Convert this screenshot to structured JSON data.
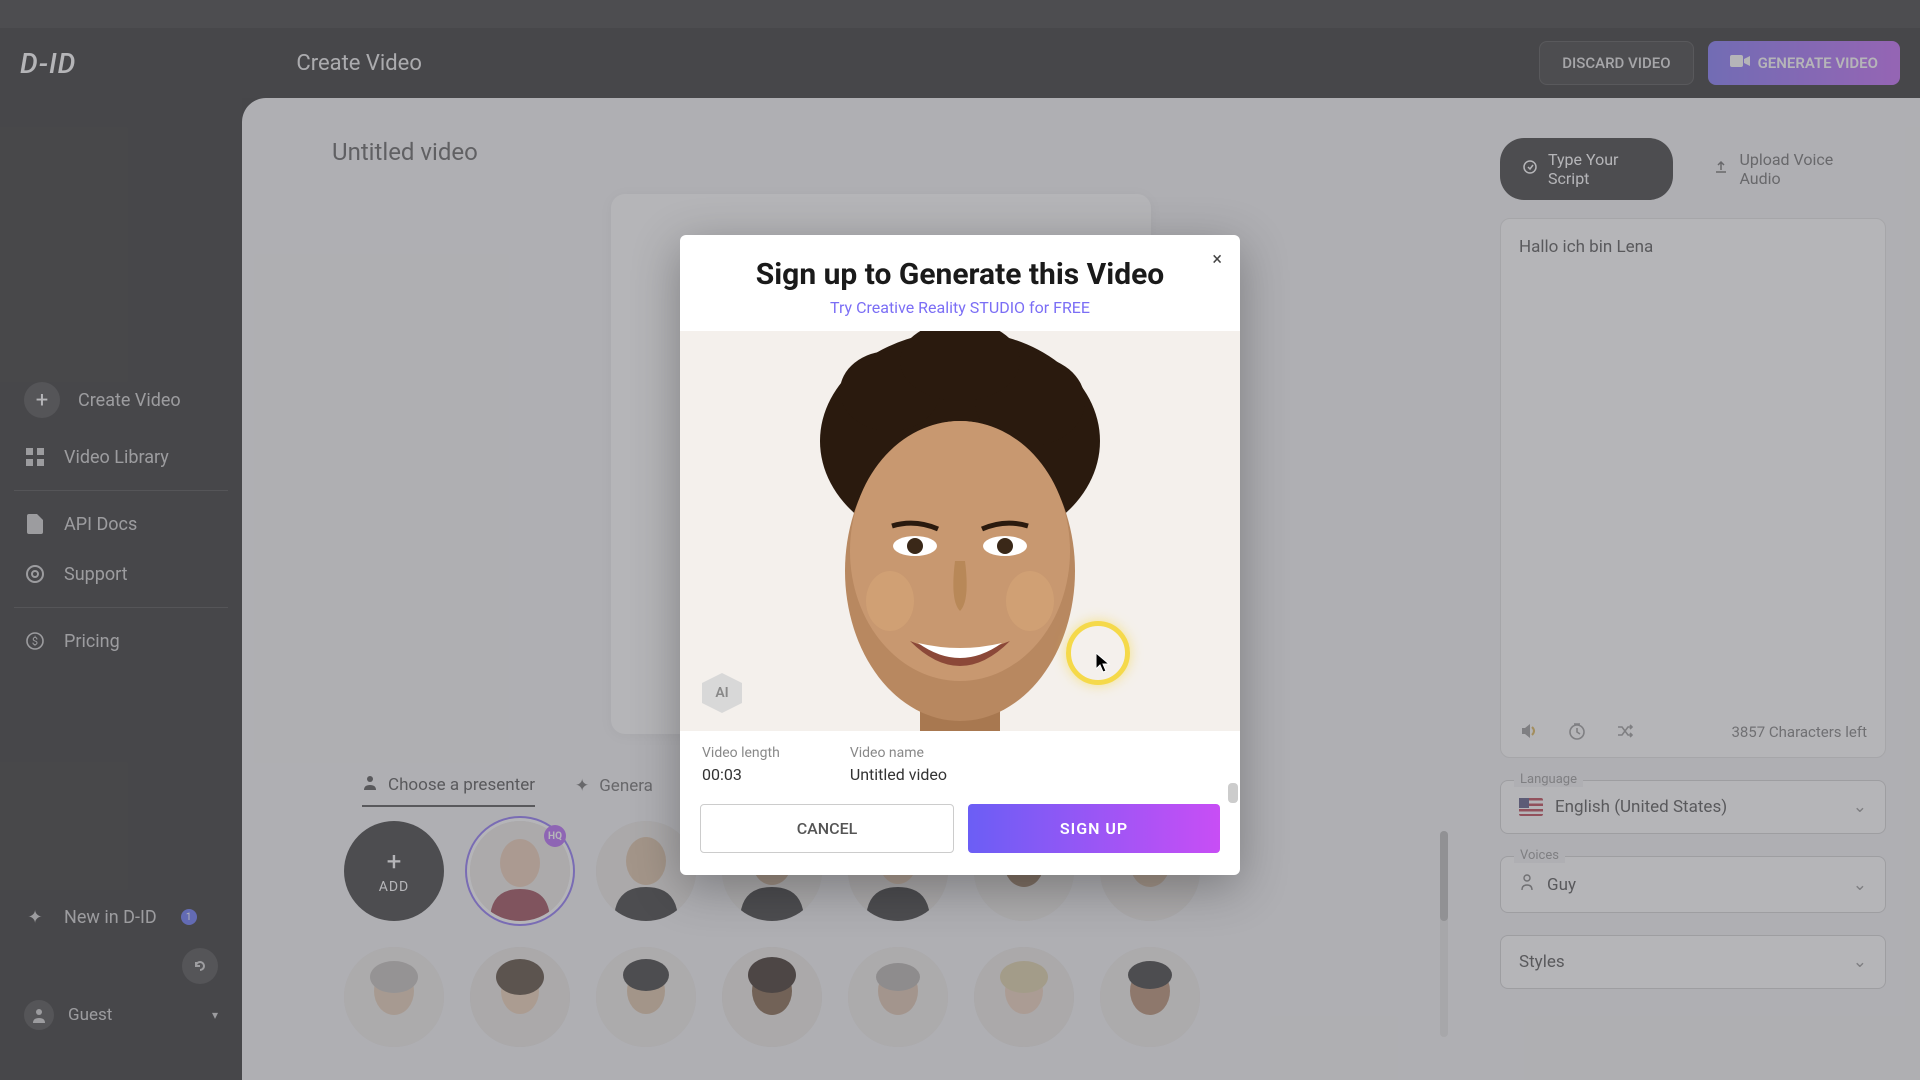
{
  "header": {
    "logo": "D-ID",
    "title": "Create Video",
    "discard": "DISCARD VIDEO",
    "generate": "GENERATE VIDEO"
  },
  "sidebar": {
    "create": "Create Video",
    "library": "Video Library",
    "api": "API Docs",
    "support": "Support",
    "pricing": "Pricing",
    "new": "New in D-ID",
    "new_count": "1",
    "guest": "Guest"
  },
  "canvas": {
    "video_title": "Untitled video",
    "tab_choose": "Choose a presenter",
    "tab_generate": "Genera",
    "add_label": "ADD",
    "hq": "HQ"
  },
  "script": {
    "tab_type": "Type Your Script",
    "tab_upload": "Upload Voice Audio",
    "text": "Hallo ich bin Lena",
    "chars_left": "3857 Characters left",
    "language_label": "Language",
    "language_value": "English (United States)",
    "voices_label": "Voices",
    "voices_value": "Guy",
    "styles_label": "Styles",
    "styles_value": "Styles"
  },
  "modal": {
    "title": "Sign up to Generate this Video",
    "subtitle": "Try Creative Reality STUDIO for FREE",
    "ai_badge": "AI",
    "length_label": "Video length",
    "length_value": "00:03",
    "name_label": "Video name",
    "name_value": "Untitled video",
    "cancel": "CANCEL",
    "signup": "SIGN UP"
  }
}
